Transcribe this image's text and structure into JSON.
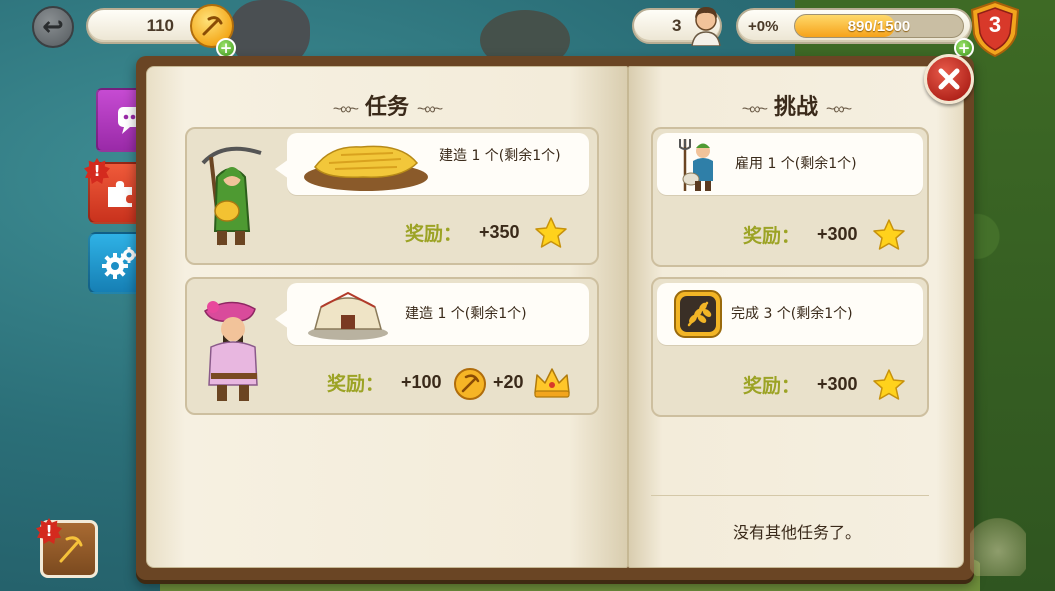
{
  "hud": {
    "coins": "110",
    "workers": "3",
    "xp_bonus": "+0%",
    "xp_progress": "890/1500",
    "xp_fraction": 0.593,
    "level": "3"
  },
  "colors": {
    "reward_label": "#9ca325",
    "chat_tab": "#b43abf",
    "puzzle_tab": "#dd4529",
    "settings_tab": "#2398cf",
    "close_button": "#c8382c"
  },
  "side_tabs": {
    "chat_icon": "chat-icon",
    "puzzle_alert": "!",
    "puzzle_icon": "puzzle-icon",
    "settings_icon": "gear-icon"
  },
  "quests_page": {
    "title": "任务",
    "quests": [
      {
        "character": "farmer-with-scythe",
        "image": "wheat-field",
        "text": "建造 1 个(剩余1个)",
        "reward_label": "奖励：",
        "rewards": [
          {
            "value": "+350",
            "icon": "star-icon"
          }
        ]
      },
      {
        "character": "merchant-pink-turban",
        "image": "market-tent",
        "text": "建造 1 个(剩余1个)",
        "reward_label": "奖励：",
        "rewards": [
          {
            "value": "+100",
            "icon": "coin-icon"
          },
          {
            "value": "+20",
            "icon": "crown-icon"
          }
        ]
      }
    ]
  },
  "challenges_page": {
    "title": "挑战",
    "challenges": [
      {
        "image": "villager-with-pitchfork",
        "text": "雇用 1 个(剩余1个)",
        "reward_label": "奖励：",
        "reward_value": "+300",
        "reward_icon": "star-icon"
      },
      {
        "image": "wheat-badge",
        "text": "完成 3 个(剩余1个)",
        "reward_label": "奖励：",
        "reward_value": "+300",
        "reward_icon": "star-icon"
      }
    ],
    "no_more_text": "没有其他任务了。"
  },
  "bottom": {
    "quest_book_alert": "!"
  }
}
